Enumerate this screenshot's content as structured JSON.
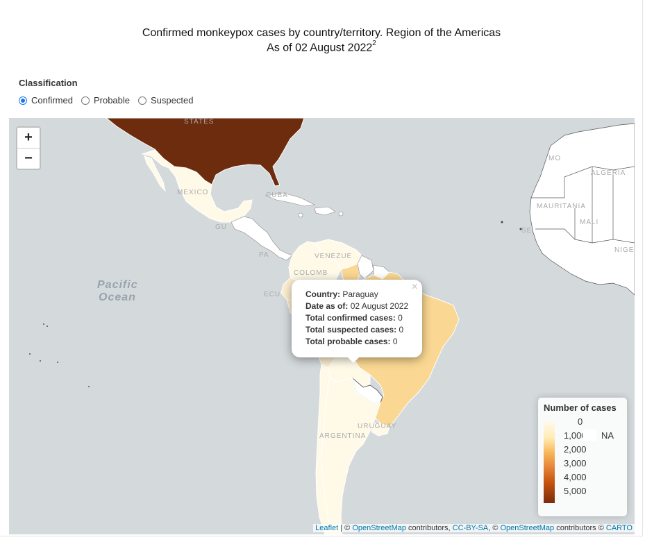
{
  "title": {
    "line1": "Confirmed monkeypox cases by country/territory. Region of the Americas",
    "line2": "As of 02 August 2022",
    "footnote": "2"
  },
  "classification": {
    "label": "Classification",
    "options": [
      {
        "label": "Confirmed",
        "selected": true
      },
      {
        "label": "Probable",
        "selected": false
      },
      {
        "label": "Suspected",
        "selected": false
      }
    ]
  },
  "zoom": {
    "in": "+",
    "out": "−"
  },
  "map_labels": {
    "states": "STATES",
    "mexico": "MEXICO",
    "cuba": "CUBA",
    "guatemala": "GU",
    "panama": "PA",
    "venezuela": "VENEZUE",
    "colombia": "COLOMB",
    "ecuador": "ECU",
    "argentina": "ARGENTINA",
    "uruguay": "URUGUAY",
    "morocco": "MO",
    "algeria": "ALGERIA",
    "mauritania": "MAURITANIA",
    "mali": "MALI",
    "niger": "NIGE",
    "senegal": "SE",
    "pacific1": "Pacific",
    "pacific2": "Ocean"
  },
  "popup": {
    "close": "×",
    "country_label": "Country:",
    "country": "Paraguay",
    "date_label": "Date as of:",
    "date": "02 August 2022",
    "confirmed_label": "Total confirmed cases:",
    "confirmed": "0",
    "suspected_label": "Total suspected cases:",
    "suspected": "0",
    "probable_label": "Total probable cases:",
    "probable": "0"
  },
  "legend": {
    "title": "Number of cases",
    "ticks": [
      "0",
      "1,000",
      "2,000",
      "3,000",
      "4,000",
      "5,000"
    ],
    "na": "NA",
    "colors": {
      "low": "#fff9ef",
      "mid": "#f7b85c",
      "high": "#7a2b0c"
    }
  },
  "attribution": {
    "leaflet": "Leaflet",
    "sep1": " | © ",
    "osm": "OpenStreetMap",
    "contrib1": " contributors, ",
    "ccbysa": "CC-BY-SA",
    "sep2": ", © ",
    "osm2": "OpenStreetMap",
    "contrib2": " contributors © ",
    "carto": "CARTO"
  },
  "map_colors": {
    "ocean": "#d4d9dc",
    "usa": "#6e2c0f",
    "brazil": "#fad792",
    "peru": "#fdeecf",
    "light": "#fffae8",
    "none": "#ffffff"
  }
}
